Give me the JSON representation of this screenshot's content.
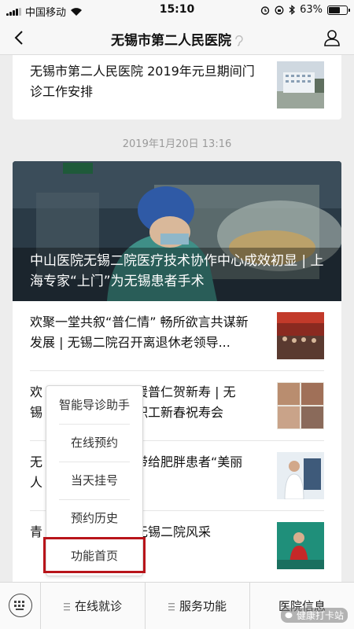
{
  "status_bar": {
    "carrier": "中国移动",
    "time": "15:10",
    "battery_label": "63%",
    "battery_level": 0.63
  },
  "nav": {
    "title": "无锡市第二人民医院"
  },
  "articles_top": [
    {
      "title": "无锡市第二人民医院 2019年元旦期间门诊工作安排"
    }
  ],
  "timestamp": "2019年1月20日 13:16",
  "hero": {
    "caption": "中山医院无锡二院医疗技术协作中心成效初显 | 上海专家“上门”为无锡患者手术"
  },
  "articles": [
    {
      "title": "欢聚一堂共叙“普仁情” 畅所欲言共谋新发展 | 无锡二院召开离退休老领导..."
    },
    {
      "title_left": "欢",
      "title_left2": "锡",
      "title_right": "暖普仁贺新寿 | 无",
      "title_right2": "职工新春祝寿会"
    },
    {
      "title_left": "无",
      "title_left2": "人",
      "title_right": "带给肥胖患者“美丽"
    },
    {
      "title_left": "青",
      "title_right": "无锡二院风采"
    }
  ],
  "popup_menu": {
    "items": [
      "智能导诊助手",
      "在线预约",
      "当天挂号",
      "预约历史",
      "功能首页"
    ]
  },
  "bottom_menu": {
    "tabs": [
      "在线就诊",
      "服务功能",
      "医院信息"
    ]
  },
  "watermark": "健康打卡站",
  "colors": {
    "highlight_border": "#b8141a",
    "background": "#ededed"
  }
}
